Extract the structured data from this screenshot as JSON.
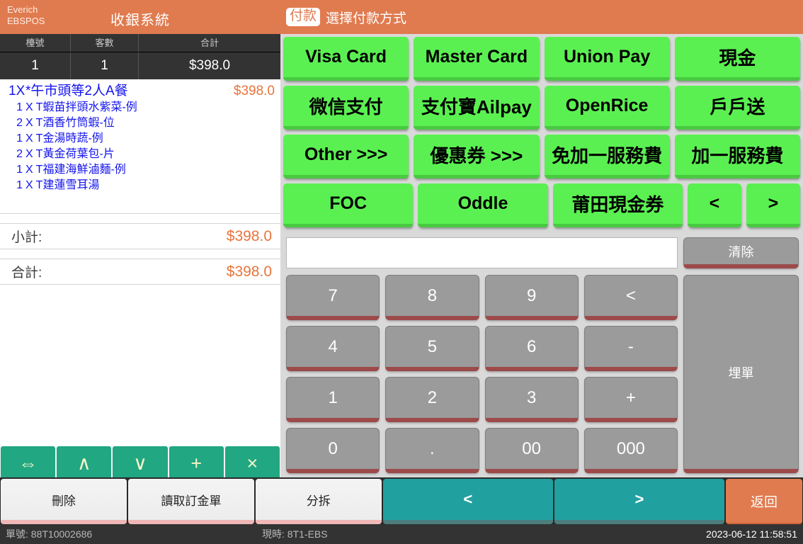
{
  "left": {
    "brand_line1": "Everich",
    "brand_line2": "EBSPOS",
    "system_title": "收銀系統",
    "table_headers": [
      "檯號",
      "客數",
      "合計"
    ],
    "table_values": [
      "1",
      "1",
      "$398.0"
    ],
    "order_items": [
      {
        "qty": "1X",
        "x": "",
        "name": "*午市頭等2人A餐",
        "price": "$398.0",
        "main": true
      },
      {
        "qty": "1",
        "x": "X",
        "name": "T蝦苗拌頭水紫菜-例",
        "price": "",
        "main": false
      },
      {
        "qty": "2",
        "x": "X",
        "name": "T酒香竹筒蝦-位",
        "price": "",
        "main": false
      },
      {
        "qty": "1",
        "x": "X",
        "name": "T金湯時蔬-例",
        "price": "",
        "main": false
      },
      {
        "qty": "2",
        "x": "X",
        "name": "T黃金荷葉包-片",
        "price": "",
        "main": false
      },
      {
        "qty": "1",
        "x": "X",
        "name": "T福建海鮮滷麵-例",
        "price": "",
        "main": false
      },
      {
        "qty": "1",
        "x": "X",
        "name": "T建蓮雪耳湯",
        "price": "",
        "main": false
      }
    ],
    "subtotal_label": "小計:",
    "subtotal_value": "$398.0",
    "total_label": "合計:",
    "total_value": "$398.0",
    "actions": [
      {
        "glyph": "⇔",
        "name": "resize-button"
      },
      {
        "glyph": "∧",
        "name": "move-up-button"
      },
      {
        "glyph": "∨",
        "name": "move-down-button"
      },
      {
        "glyph": "+",
        "name": "increase-qty-button"
      },
      {
        "glyph": "×",
        "name": "remove-item-button"
      }
    ]
  },
  "payment": {
    "badge": "付款",
    "header_title": "選擇付款方式",
    "rows": [
      [
        {
          "label": "Visa Card",
          "cjk": false,
          "narrow": false
        },
        {
          "label": "Master Card",
          "cjk": false,
          "narrow": false
        },
        {
          "label": "Union Pay",
          "cjk": false,
          "narrow": false
        },
        {
          "label": "現金",
          "cjk": true,
          "narrow": false
        }
      ],
      [
        {
          "label": "微信支付",
          "cjk": true,
          "narrow": false
        },
        {
          "label": "支付寶Ailpay",
          "cjk": true,
          "narrow": false
        },
        {
          "label": "OpenRice",
          "cjk": false,
          "narrow": false
        },
        {
          "label": "戶戶送",
          "cjk": true,
          "narrow": false
        }
      ],
      [
        {
          "label": "Other >>>",
          "cjk": false,
          "narrow": false
        },
        {
          "label": "優惠券 >>>",
          "cjk": true,
          "narrow": false
        },
        {
          "label": "免加一服務費",
          "cjk": true,
          "narrow": false
        },
        {
          "label": "加一服務費",
          "cjk": true,
          "narrow": false
        }
      ],
      [
        {
          "label": "FOC",
          "cjk": false,
          "narrow": false
        },
        {
          "label": "Oddle",
          "cjk": false,
          "narrow": false
        },
        {
          "label": "莆田現金券",
          "cjk": true,
          "narrow": false
        },
        {
          "label": "<",
          "cjk": false,
          "narrow": true
        },
        {
          "label": ">",
          "cjk": false,
          "narrow": true
        }
      ]
    ]
  },
  "keypad": {
    "amount_value": "",
    "amount_placeholder": "",
    "clear_label": "清除",
    "settle_label": "埋單",
    "keys": [
      "7",
      "8",
      "9",
      "<",
      "4",
      "5",
      "6",
      "-",
      "1",
      "2",
      "3",
      "+",
      "0",
      ".",
      "00",
      "000"
    ]
  },
  "bottom_bar": {
    "delete_label": "刪除",
    "read_deposit_label": "讀取訂金單",
    "split_label": "分拆",
    "prev_label": "<",
    "next_label": ">",
    "back_label": "返回"
  },
  "status_bar": {
    "order_no": "單號: 88T10002686",
    "terminal": "現時: 8T1-EBS",
    "datetime": "2023-06-12 11:58:51"
  },
  "colors": {
    "accent_orange": "#e07b4f",
    "pay_green": "#5bf052",
    "teal": "#21a0a0",
    "action_teal": "#21a782",
    "price_orange": "#e8743b",
    "item_blue": "#1414ee"
  }
}
